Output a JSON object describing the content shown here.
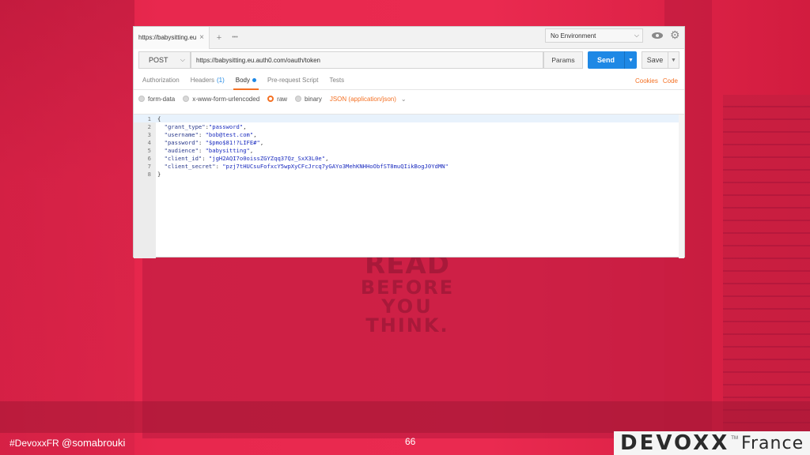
{
  "slide": {
    "sign_lines": [
      "READ",
      "BEFORE",
      "YOU",
      "THINK."
    ],
    "hashtag": "#DevoxxFR",
    "handle": "@somabrouki",
    "page_number": "66",
    "logo_word": "DEVOXX",
    "logo_tm": "TM",
    "logo_country": "France"
  },
  "tabbar": {
    "tab_label": "https://babysitting.eu",
    "close": "×",
    "add": "+",
    "more": "•••",
    "environment": "No Environment"
  },
  "request": {
    "method": "POST",
    "url": "https://babysitting.eu.auth0.com/oauth/token",
    "params_label": "Params",
    "send_label": "Send",
    "save_label": "Save"
  },
  "subtabs": {
    "authorization": "Authorization",
    "headers": "Headers",
    "headers_count": "(1)",
    "body": "Body",
    "prerequest": "Pre-request Script",
    "tests": "Tests",
    "cookies": "Cookies",
    "code": "Code"
  },
  "body_options": {
    "form_data": "form-data",
    "urlencoded": "x-www-form-urlencoded",
    "raw": "raw",
    "binary": "binary",
    "selected": "raw",
    "content_type": "JSON (application/json)"
  },
  "editor": {
    "line_numbers": [
      "1",
      "2",
      "3",
      "4",
      "5",
      "6",
      "7",
      "8"
    ],
    "open_brace": "{",
    "close_brace": "}",
    "fields": [
      {
        "key": "\"grant_type\"",
        "sep": ":",
        "value": "\"password\"",
        "comma": ","
      },
      {
        "key": "\"username\"",
        "sep": ": ",
        "value": "\"bob@test.com\"",
        "comma": ","
      },
      {
        "key": "\"password\"",
        "sep": ": ",
        "value": "\"$pmo$81!?LIFE#\"",
        "comma": ","
      },
      {
        "key": "\"audience\"",
        "sep": ": ",
        "value": "\"babysitting\"",
        "comma": ","
      },
      {
        "key": "\"client_id\"",
        "sep": ": ",
        "value": "\"jgH2AQI7o0oissZGYZqq37Qz_SxX3L0e\"",
        "comma": ","
      },
      {
        "key": "\"client_secret\"",
        "sep": ": ",
        "value": "\"pzj7tHUCsuFofxcY5wpXyCFcJrcq7yGAYo3MehKNHHoObfST8muQIikBogJ0YdMN\"",
        "comma": ""
      }
    ]
  },
  "colors": {
    "accent_orange": "#f47023",
    "send_blue": "#1e88e5",
    "slide_red": "#e8244a"
  }
}
